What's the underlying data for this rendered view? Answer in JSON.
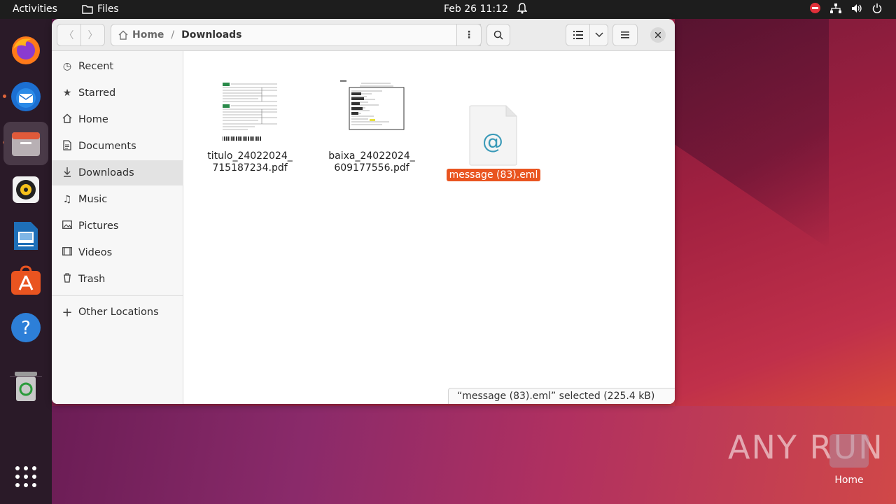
{
  "topbar": {
    "activities": "Activities",
    "app_name": "Files",
    "datetime": "Feb 26  11:12"
  },
  "dock": {
    "items": [
      "firefox-icon",
      "thunderbird-icon",
      "files-icon",
      "rhythmbox-icon",
      "libreoffice-writer-icon",
      "app-center-icon",
      "help-icon",
      "trash-icon",
      "show-apps-icon"
    ]
  },
  "window": {
    "path": {
      "home": "Home",
      "current": "Downloads"
    },
    "sidebar": {
      "items": [
        {
          "label": "Recent",
          "icon": "clock-icon"
        },
        {
          "label": "Starred",
          "icon": "star-icon"
        },
        {
          "label": "Home",
          "icon": "home-icon"
        },
        {
          "label": "Documents",
          "icon": "document-icon"
        },
        {
          "label": "Downloads",
          "icon": "download-icon"
        },
        {
          "label": "Music",
          "icon": "music-icon"
        },
        {
          "label": "Pictures",
          "icon": "picture-icon"
        },
        {
          "label": "Videos",
          "icon": "video-icon"
        },
        {
          "label": "Trash",
          "icon": "trash-icon"
        }
      ],
      "other_locations": "Other Locations"
    },
    "files": [
      {
        "name_line1": "titulo_24022024_",
        "name_line2": "715187234.pdf"
      },
      {
        "name_line1": "baixa_24022024_",
        "name_line2": "609177556.pdf"
      },
      {
        "name": "message (83).eml",
        "selected": true
      }
    ],
    "status": "“message (83).eml” selected (225.4 kB)"
  },
  "desktop": {
    "home_label": "Home",
    "watermark": "ANY RUN"
  },
  "colors": {
    "accent": "#e95420",
    "topbar": "#1d1d1d"
  }
}
